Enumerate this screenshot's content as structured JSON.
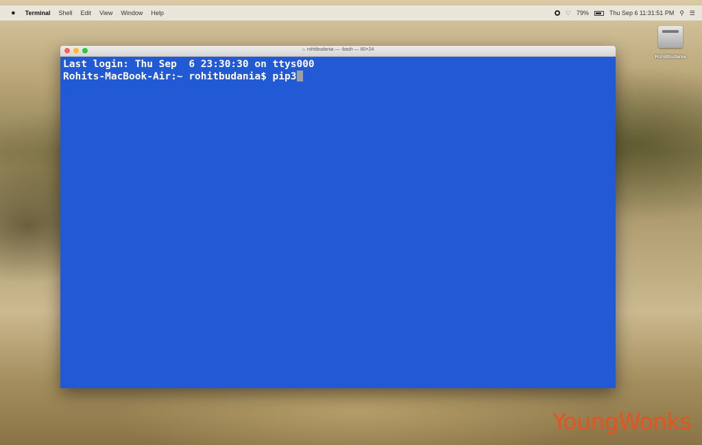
{
  "menubar": {
    "app_name": "Terminal",
    "items": [
      "Shell",
      "Edit",
      "View",
      "Window",
      "Help"
    ],
    "battery": "79%",
    "datetime": "Thu Sep 6  11:31:51 PM"
  },
  "desktop": {
    "drive_label": "RohitBudania"
  },
  "terminal": {
    "title": "rohitbudania — -bash — 80×24",
    "lines": [
      "Last login: Thu Sep  6 23:30:30 on ttys000",
      "Rohits-MacBook-Air:~ rohitbudania$ pip3"
    ],
    "background_color": "#2259d4",
    "text_color": "#ffffff"
  },
  "watermark": {
    "text": "YoungWonks",
    "color": "#e8521f"
  }
}
